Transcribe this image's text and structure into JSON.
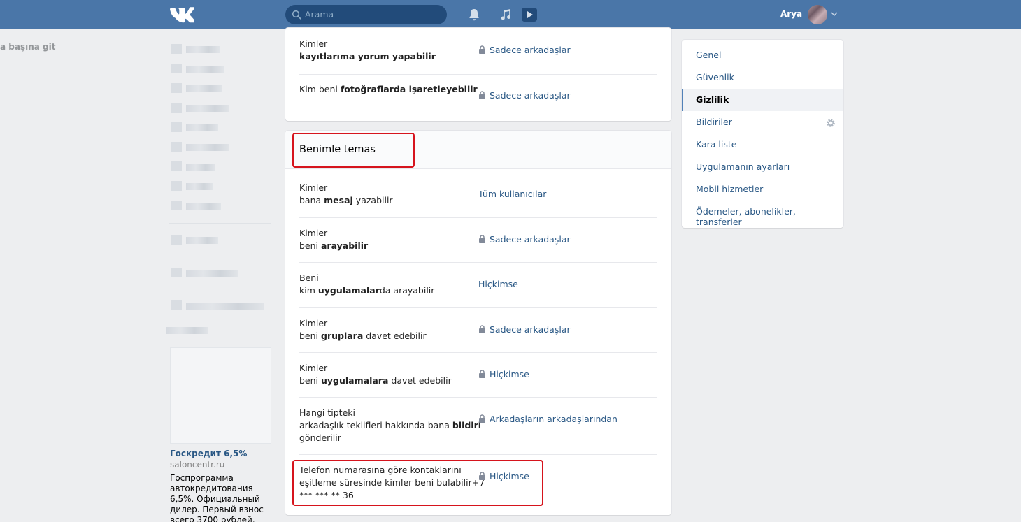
{
  "header": {
    "search_placeholder": "Arama",
    "user_name": "Arya",
    "icons": [
      "vk-logo-icon",
      "search-icon",
      "bell-icon",
      "music-icon",
      "video-icon",
      "chevron-down-icon"
    ]
  },
  "left": {
    "back_to_top": "a başına git",
    "ad": {
      "title": "Госкредит 6,5%",
      "domain": "saloncentr.ru",
      "text": "Госпрограмма автокредитования 6,5%. Официальный дилер. Первый взнос всего 3700 рублей."
    }
  },
  "top_panel": {
    "rows": [
      {
        "line1": "Kimler",
        "bold": "kayıtlarıma yorum yapabilir",
        "value": "Sadece arkadaşlar",
        "locked": true
      },
      {
        "pre": "Kim beni ",
        "bold": "fotoğraflarda işaretleyebilir",
        "value": "Sadece arkadaşlar",
        "locked": true
      }
    ]
  },
  "contact_section": {
    "title": "Benimle temas",
    "rows": [
      {
        "line1": "Kimler",
        "pre": "bana ",
        "bold": "mesaj",
        "post": " yazabilir",
        "value": "Tüm kullanıcılar",
        "locked": false
      },
      {
        "line1": "Kimler",
        "pre": "beni ",
        "bold": "arayabilir",
        "post": "",
        "value": "Sadece arkadaşlar",
        "locked": true
      },
      {
        "line1": "Beni",
        "pre": "kim ",
        "bold": "uygulamalar",
        "post": "da arayabilir",
        "value": "Hiçkimse",
        "locked": false
      },
      {
        "line1": "Kimler",
        "pre": "beni ",
        "bold": "gruplara",
        "post": " davet edebilir",
        "value": "Sadece arkadaşlar",
        "locked": true
      },
      {
        "line1": "Kimler",
        "pre": "beni ",
        "bold": "uygulamalara",
        "post": " davet edebilir",
        "value": "Hiçkimse",
        "locked": true
      },
      {
        "line1": "Hangi tipteki",
        "pre": "arkadaşlık teklifleri hakkında bana ",
        "bold": "bildiri",
        "line3": "gönderilir",
        "value": "Arkadaşların arkadaşlarından",
        "locked": true
      },
      {
        "line1": "Telefon numarasına göre kontaklarını",
        "line2": "eşitleme süresinde kimler beni bulabilir+7",
        "line3": "*** *** ** 36",
        "value": "Hiçkimse",
        "locked": true
      }
    ]
  },
  "right_menu": {
    "items": [
      {
        "label": "Genel"
      },
      {
        "label": "Güvenlik"
      },
      {
        "label": "Gizlilik",
        "active": true
      },
      {
        "label": "Bildiriler",
        "gear": true
      },
      {
        "label": "Kara liste"
      },
      {
        "label": "Uygulamanın ayarları"
      },
      {
        "label": "Mobil hizmetler"
      },
      {
        "label": "Ödemeler, abonelikler, transferler"
      }
    ]
  },
  "colors": {
    "header_bg": "#4a76a8",
    "link": "#2a5885",
    "highlight": "#d6141d",
    "page_bg": "#edeef0"
  }
}
